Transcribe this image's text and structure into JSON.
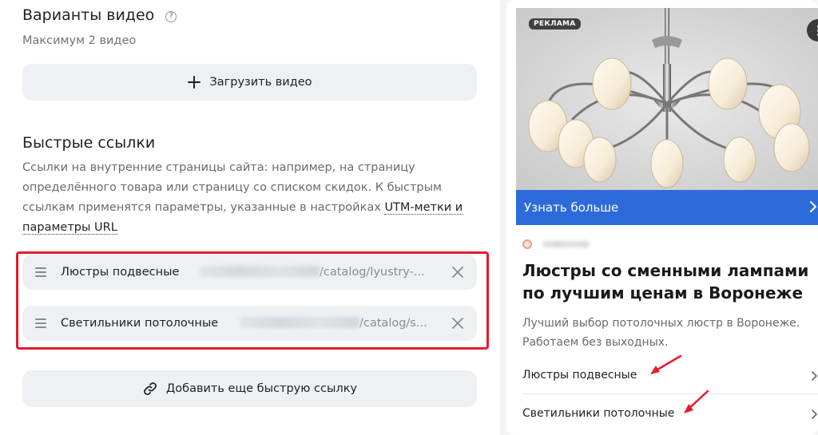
{
  "video": {
    "title": "Варианты видео",
    "help_icon": "?",
    "subtitle": "Максимум 2 видео",
    "upload_label": "Загрузить видео"
  },
  "quicklinks": {
    "title": "Быстрые ссылки",
    "description": "Ссылки на внутренние страницы сайта: например, на страницу определённого товара или страницу со списком скидок. К быстрым ссылкам применятся параметры, указанные в настройках ",
    "utm_link": "UTM-метки и параметры URL",
    "items": [
      {
        "name": "Люстры подвесные",
        "url": "/catalog/lyustry-..."
      },
      {
        "name": "Светильники потолочные",
        "url": "/catalog/s..."
      }
    ],
    "add_label": "Добавить еще быструю ссылку"
  },
  "preview": {
    "badge": "РЕКЛАМА",
    "cta": "Узнать больше",
    "title": "Люстры со сменными лампами по лучшим ценам в Воронеже",
    "text": "Лучший выбор потолочных люстр в Воронеже. Работаем без выходных.",
    "sitelinks": [
      "Люстры подвесные",
      "Светильники потолочные"
    ]
  },
  "colors": {
    "accent_blue": "#2d6bdb",
    "highlight_red": "#e8192c",
    "button_bg": "#eef0f3"
  },
  "icons": [
    "help-circle-icon",
    "plus-icon",
    "drag-handle-icon",
    "close-icon",
    "link-icon",
    "more-vertical-icon",
    "chevron-right-icon",
    "favicon-icon",
    "annotation-arrow-icon"
  ]
}
